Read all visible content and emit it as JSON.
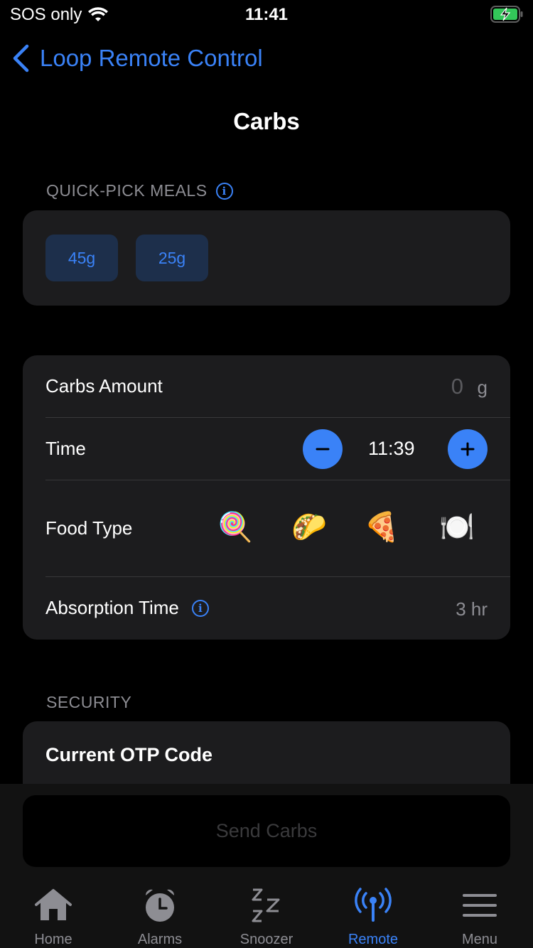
{
  "status": {
    "carrier": "SOS only",
    "time": "11:41"
  },
  "nav": {
    "back_label": "Loop Remote Control",
    "title": "Carbs"
  },
  "quick_pick": {
    "header": "QUICK-PICK MEALS",
    "chips": [
      "45g",
      "25g"
    ]
  },
  "carbs": {
    "amount_label": "Carbs Amount",
    "amount_value": "0",
    "amount_unit": "g",
    "time_label": "Time",
    "time_value": "11:39",
    "food_type_label": "Food Type",
    "food_types": [
      "🍭",
      "🌮",
      "🍕",
      "🍽️"
    ],
    "absorption_label": "Absorption Time",
    "absorption_value": "3 hr"
  },
  "security": {
    "header": "SECURITY",
    "otp_label": "Current OTP Code"
  },
  "send_button": "Send Carbs",
  "tabs": [
    {
      "label": "Home",
      "icon": "house-icon"
    },
    {
      "label": "Alarms",
      "icon": "alarm-clock-icon"
    },
    {
      "label": "Snoozer",
      "icon": "zzz-icon"
    },
    {
      "label": "Remote",
      "icon": "antenna-icon",
      "active": true
    },
    {
      "label": "Menu",
      "icon": "menu-icon"
    }
  ],
  "colors": {
    "accent": "#3a82f7",
    "background": "#000000",
    "card": "#1c1c1e"
  }
}
